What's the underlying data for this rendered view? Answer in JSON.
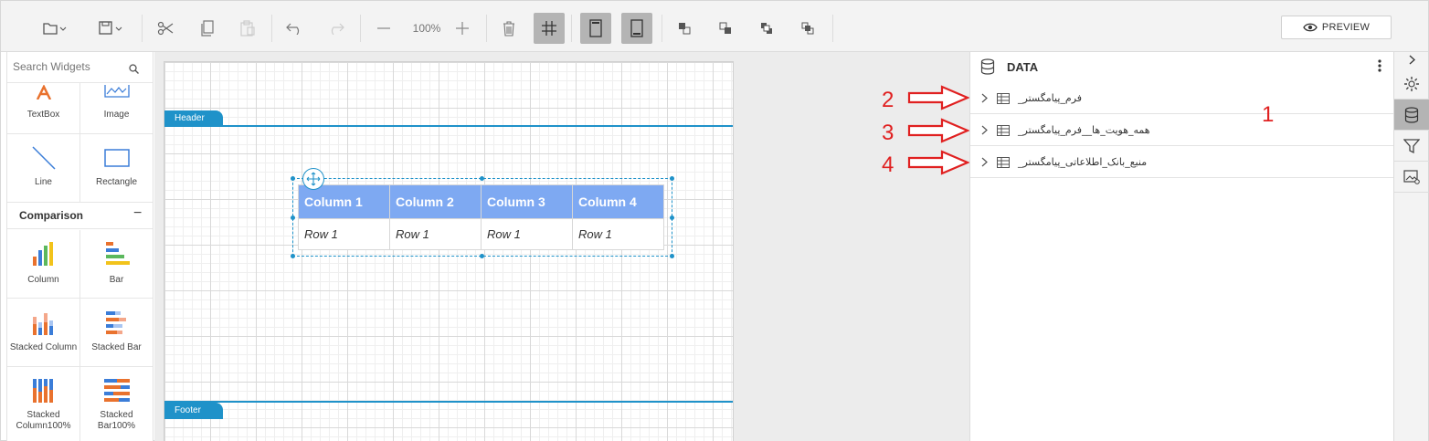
{
  "toolbar": {
    "zoom": "100%",
    "preview_label": "PREVIEW"
  },
  "widgets": {
    "search_placeholder": "Search Widgets",
    "basic": [
      {
        "label": "TextBox",
        "icon": "textbox-icon"
      },
      {
        "label": "Image",
        "icon": "image-icon"
      },
      {
        "label": "Line",
        "icon": "line-icon"
      },
      {
        "label": "Rectangle",
        "icon": "rectangle-icon"
      }
    ],
    "comparison_title": "Comparison",
    "comparison_toggle": "−",
    "comparison": [
      {
        "label": "Column",
        "icon": "column-chart-icon"
      },
      {
        "label": "Bar",
        "icon": "bar-chart-icon"
      },
      {
        "label": "Stacked Column",
        "icon": "stacked-column-icon"
      },
      {
        "label": "Stacked Bar",
        "icon": "stacked-bar-icon"
      },
      {
        "label": "Stacked Column100%",
        "icon": "stacked-column100-icon"
      },
      {
        "label": "Stacked Bar100%",
        "icon": "stacked-bar100-icon"
      }
    ]
  },
  "canvas": {
    "header_label": "Header",
    "footer_label": "Footer",
    "table": {
      "columns": [
        "Column 1",
        "Column 2",
        "Column 3",
        "Column 4"
      ],
      "rows": [
        [
          "Row 1",
          "Row 1",
          "Row 1",
          "Row 1"
        ]
      ]
    }
  },
  "annotations": [
    "1",
    "2",
    "3",
    "4"
  ],
  "data_panel": {
    "title": "DATA",
    "datasets": [
      {
        "name": "_فرم_پیامگستر"
      },
      {
        "name": "_همه_هویت_ها__فرم_پیامگستر"
      },
      {
        "name": "_منبع_بانک_اطلاعاتی_پیامگستر"
      }
    ]
  },
  "colors": {
    "accent": "#1f92c9",
    "header_fill": "#7ea9f2",
    "annotation": "#e02020",
    "active_button": "#b4b4b4"
  }
}
